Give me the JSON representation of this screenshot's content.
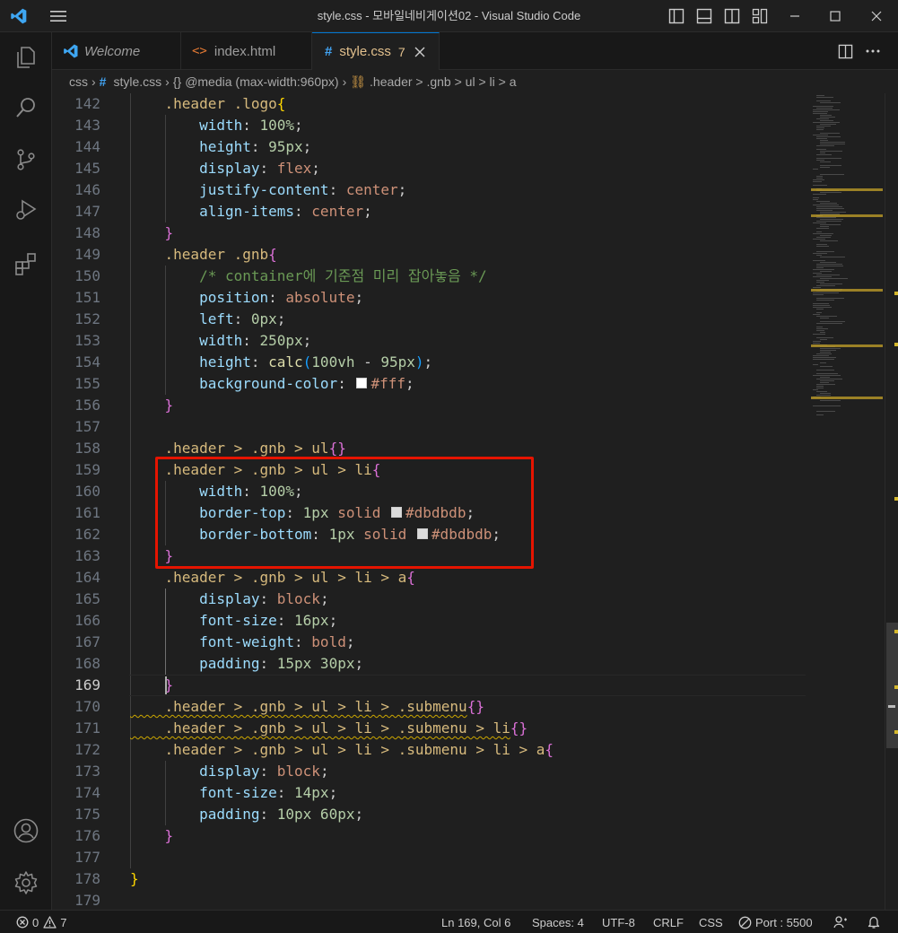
{
  "window": {
    "title": "style.css - 모바일네비게이션02 - Visual Studio Code"
  },
  "activity_bar": {
    "icons": [
      "explorer-icon",
      "search-icon",
      "source-control-icon",
      "run-debug-icon",
      "extensions-icon",
      "accounts-icon",
      "manage-gear-icon"
    ]
  },
  "tabs": [
    {
      "label": "Welcome",
      "icon": "vscode-logo-icon",
      "italic": true
    },
    {
      "label": "index.html",
      "icon": "html-icon"
    },
    {
      "label": "style.css",
      "icon": "css-hash-icon",
      "badge": "7",
      "active": true
    }
  ],
  "breadcrumbs": {
    "folder": "css",
    "file": "style.css",
    "media": "@media (max-width:960px)",
    "rule": ".header > .gnb > ul > li > a"
  },
  "editor": {
    "current_line": 169,
    "lines": [
      {
        "n": "142",
        "tokens": [
          [
            "sel",
            "    .header .logo"
          ],
          [
            "b1",
            "{"
          ]
        ]
      },
      {
        "n": "143",
        "tokens": [
          [
            "prop",
            "        width"
          ],
          [
            "p",
            ": "
          ],
          [
            "num",
            "100%"
          ],
          [
            "p",
            ";"
          ]
        ]
      },
      {
        "n": "144",
        "tokens": [
          [
            "prop",
            "        height"
          ],
          [
            "p",
            ": "
          ],
          [
            "num",
            "95px"
          ],
          [
            "p",
            ";"
          ]
        ]
      },
      {
        "n": "145",
        "tokens": [
          [
            "prop",
            "        display"
          ],
          [
            "p",
            ": "
          ],
          [
            "val",
            "flex"
          ],
          [
            "p",
            ";"
          ]
        ]
      },
      {
        "n": "146",
        "tokens": [
          [
            "prop",
            "        justify-content"
          ],
          [
            "p",
            ": "
          ],
          [
            "val",
            "center"
          ],
          [
            "p",
            ";"
          ]
        ]
      },
      {
        "n": "147",
        "tokens": [
          [
            "prop",
            "        align-items"
          ],
          [
            "p",
            ": "
          ],
          [
            "val",
            "center"
          ],
          [
            "p",
            ";"
          ]
        ]
      },
      {
        "n": "148",
        "tokens": [
          [
            "b2",
            "    }"
          ]
        ]
      },
      {
        "n": "149",
        "tokens": [
          [
            "sel",
            "    .header .gnb"
          ],
          [
            "b2",
            "{"
          ]
        ]
      },
      {
        "n": "150",
        "tokens": [
          [
            "cm",
            "        /* container에 기준점 미리 잡아놓음 */"
          ]
        ]
      },
      {
        "n": "151",
        "tokens": [
          [
            "prop",
            "        position"
          ],
          [
            "p",
            ": "
          ],
          [
            "val",
            "absolute"
          ],
          [
            "p",
            ";"
          ]
        ]
      },
      {
        "n": "152",
        "tokens": [
          [
            "prop",
            "        left"
          ],
          [
            "p",
            ": "
          ],
          [
            "num",
            "0px"
          ],
          [
            "p",
            ";"
          ]
        ]
      },
      {
        "n": "153",
        "tokens": [
          [
            "prop",
            "        width"
          ],
          [
            "p",
            ": "
          ],
          [
            "num",
            "250px"
          ],
          [
            "p",
            ";"
          ]
        ]
      },
      {
        "n": "154",
        "tokens": [
          [
            "prop",
            "        height"
          ],
          [
            "p",
            ": "
          ],
          [
            "fn",
            "calc"
          ],
          [
            "b3",
            "("
          ],
          [
            "num",
            "100vh"
          ],
          [
            "p",
            " - "
          ],
          [
            "num",
            "95px"
          ],
          [
            "b3",
            ")"
          ],
          [
            "p",
            ";"
          ]
        ]
      },
      {
        "n": "155",
        "tokens": [
          [
            "prop",
            "        background-color"
          ],
          [
            "p",
            ": "
          ],
          [
            "sw",
            "#ffffff"
          ],
          [
            "val",
            "#fff"
          ],
          [
            "p",
            ";"
          ]
        ]
      },
      {
        "n": "156",
        "tokens": [
          [
            "b2",
            "    }"
          ]
        ]
      },
      {
        "n": "157",
        "tokens": []
      },
      {
        "n": "158",
        "tokens": [
          [
            "sel",
            "    .header > .gnb > ul"
          ],
          [
            "b2",
            "{}"
          ]
        ]
      },
      {
        "n": "159",
        "tokens": [
          [
            "sel",
            "    .header > .gnb > ul > li"
          ],
          [
            "b2",
            "{"
          ]
        ]
      },
      {
        "n": "160",
        "tokens": [
          [
            "prop",
            "        width"
          ],
          [
            "p",
            ": "
          ],
          [
            "num",
            "100%"
          ],
          [
            "p",
            ";"
          ]
        ]
      },
      {
        "n": "161",
        "tokens": [
          [
            "prop",
            "        border-top"
          ],
          [
            "p",
            ": "
          ],
          [
            "num",
            "1px"
          ],
          [
            "p",
            " "
          ],
          [
            "val",
            "solid"
          ],
          [
            "p",
            " "
          ],
          [
            "sw",
            "#dbdbdb"
          ],
          [
            "val",
            "#dbdbdb"
          ],
          [
            "p",
            ";"
          ]
        ]
      },
      {
        "n": "162",
        "tokens": [
          [
            "prop",
            "        border-bottom"
          ],
          [
            "p",
            ": "
          ],
          [
            "num",
            "1px"
          ],
          [
            "p",
            " "
          ],
          [
            "val",
            "solid"
          ],
          [
            "p",
            " "
          ],
          [
            "sw",
            "#dbdbdb"
          ],
          [
            "val",
            "#dbdbdb"
          ],
          [
            "p",
            ";"
          ]
        ]
      },
      {
        "n": "163",
        "tokens": [
          [
            "b2",
            "    }"
          ]
        ]
      },
      {
        "n": "164",
        "tokens": [
          [
            "sel",
            "    .header > .gnb > ul > li > a"
          ],
          [
            "b2",
            "{"
          ]
        ]
      },
      {
        "n": "165",
        "tokens": [
          [
            "prop",
            "        display"
          ],
          [
            "p",
            ": "
          ],
          [
            "val",
            "block"
          ],
          [
            "p",
            ";"
          ]
        ]
      },
      {
        "n": "166",
        "tokens": [
          [
            "prop",
            "        font-size"
          ],
          [
            "p",
            ": "
          ],
          [
            "num",
            "16px"
          ],
          [
            "p",
            ";"
          ]
        ]
      },
      {
        "n": "167",
        "tokens": [
          [
            "prop",
            "        font-weight"
          ],
          [
            "p",
            ": "
          ],
          [
            "val",
            "bold"
          ],
          [
            "p",
            ";"
          ]
        ]
      },
      {
        "n": "168",
        "tokens": [
          [
            "prop",
            "        padding"
          ],
          [
            "p",
            ": "
          ],
          [
            "num",
            "15px 30px"
          ],
          [
            "p",
            ";"
          ]
        ]
      },
      {
        "n": "169",
        "tokens": [
          [
            "b2",
            "    }"
          ]
        ]
      },
      {
        "n": "170",
        "tokens": [
          [
            "sq",
            "    .header > .gnb > ul > li > .submenu"
          ],
          [
            "b2",
            "{}"
          ]
        ]
      },
      {
        "n": "171",
        "tokens": [
          [
            "sq",
            "    .header > .gnb > ul > li > .submenu > li"
          ],
          [
            "b2",
            "{}"
          ]
        ]
      },
      {
        "n": "172",
        "tokens": [
          [
            "sel",
            "    .header > .gnb > ul > li > .submenu > li > a"
          ],
          [
            "b2",
            "{"
          ]
        ]
      },
      {
        "n": "173",
        "tokens": [
          [
            "prop",
            "        display"
          ],
          [
            "p",
            ": "
          ],
          [
            "val",
            "block"
          ],
          [
            "p",
            ";"
          ]
        ]
      },
      {
        "n": "174",
        "tokens": [
          [
            "prop",
            "        font-size"
          ],
          [
            "p",
            ": "
          ],
          [
            "num",
            "14px"
          ],
          [
            "p",
            ";"
          ]
        ]
      },
      {
        "n": "175",
        "tokens": [
          [
            "prop",
            "        padding"
          ],
          [
            "p",
            ": "
          ],
          [
            "num",
            "10px 60px"
          ],
          [
            "p",
            ";"
          ]
        ]
      },
      {
        "n": "176",
        "tokens": [
          [
            "b2",
            "    }"
          ]
        ]
      },
      {
        "n": "177",
        "tokens": []
      },
      {
        "n": "178",
        "tokens": [
          [
            "b1",
            "}"
          ]
        ]
      },
      {
        "n": "179",
        "tokens": []
      }
    ]
  },
  "status_bar": {
    "errors": "0",
    "warnings": "7",
    "position": "Ln 169, Col 6",
    "spaces": "Spaces: 4",
    "encoding": "UTF-8",
    "eol": "CRLF",
    "language": "CSS",
    "port": "Port : 5500"
  },
  "colors": {
    "accent": "#0078d4",
    "highlight_box": "#e51400",
    "warning": "#cca700"
  }
}
